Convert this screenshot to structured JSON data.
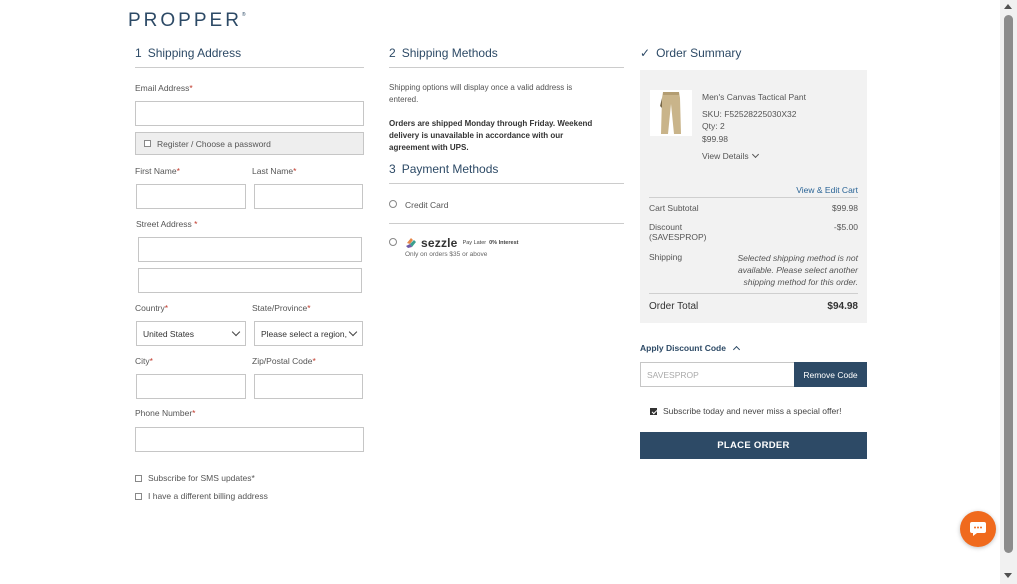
{
  "brand": {
    "logo_text": "PROPPER",
    "registered_mark": "®",
    "color": "#2d4a66"
  },
  "shipping_address": {
    "num": "1",
    "title": "Shipping Address",
    "email_label": "Email Address",
    "register_label": "Register / Choose a password",
    "first_name_label": "First Name",
    "last_name_label": "Last Name",
    "street_label": "Street Address",
    "country_label": "Country",
    "country_value": "United States",
    "state_label": "State/Province",
    "state_value": "Please select a region,",
    "city_label": "City",
    "zip_label": "Zip/Postal Code",
    "phone_label": "Phone Number",
    "required_mark": "*",
    "sms_label": "Subscribe for SMS updates*",
    "billing_label": "I have a different billing address"
  },
  "shipping_methods": {
    "num": "2",
    "title": "Shipping Methods",
    "note_line1": "Shipping options will display once a valid address is",
    "note_line2": "entered.",
    "bold_line1": "Orders are shipped Monday through Friday. Weekend",
    "bold_line2": "delivery is unavailable in accordance with our",
    "bold_line3": "agreement with UPS."
  },
  "payment_methods": {
    "num": "3",
    "title": "Payment Methods",
    "credit_card_label": "Credit Card",
    "sezzle_logo": "sezzle",
    "sezzle_tagline": "Pay Later",
    "sezzle_interest": "0% Interest",
    "sezzle_note": "Only on orders $35 or above"
  },
  "order_summary": {
    "check": "✓",
    "title": "Order Summary",
    "product_name": "Men's Canvas Tactical Pant",
    "sku": "SKU: F52528225030X32",
    "qty": "Qty: 2",
    "price": "$99.98",
    "view_details": "View Details",
    "view_edit_cart": "View & Edit Cart",
    "cart_subtotal_label": "Cart Subtotal",
    "cart_subtotal_value": "$99.98",
    "discount_label_1": "Discount",
    "discount_label_2": "(SAVESPROP)",
    "discount_value": "-$5.00",
    "shipping_label": "Shipping",
    "shipping_msg_1": "Selected shipping method is not",
    "shipping_msg_2": "available. Please select another",
    "shipping_msg_3": "shipping method for this order.",
    "order_total_label": "Order Total",
    "order_total_value": "$94.98"
  },
  "discount": {
    "toggle_label": "Apply Discount Code",
    "code_placeholder": "SAVESPROP",
    "remove_button": "Remove Code"
  },
  "subscribe_label": "Subscribe today and never miss a special offer!",
  "subscribe_checked": true,
  "place_order_label": "PLACE ORDER",
  "colors": {
    "accent": "#2d4a66",
    "chat": "#f06a1d",
    "link": "#2a6496"
  }
}
